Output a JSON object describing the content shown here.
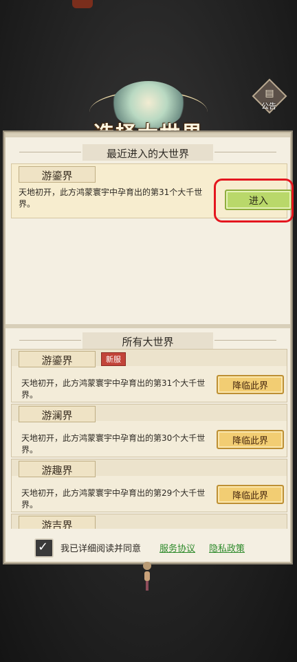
{
  "notice": {
    "label": "公告"
  },
  "title": {
    "text": "选择大世界"
  },
  "recent": {
    "section_title": "最近进入的大世界",
    "world": {
      "name": "游鎏界",
      "description": "天地初开，此方鸿蒙寰宇中孕育出的第31个大千世界。",
      "button": "进入"
    }
  },
  "all": {
    "section_title": "所有大世界",
    "worlds": [
      {
        "name": "游鎏界",
        "badge": "新服",
        "description": "天地初开，此方鸿蒙寰宇中孕育出的第31个大千世界。",
        "button": "降临此界"
      },
      {
        "name": "游澜界",
        "badge": "",
        "description": "天地初开，此方鸿蒙寰宇中孕育出的第30个大千世界。",
        "button": "降临此界"
      },
      {
        "name": "游趣界",
        "badge": "",
        "description": "天地初开，此方鸿蒙寰宇中孕育出的第29个大千世界。",
        "button": "降临此界"
      },
      {
        "name": "游吉界",
        "badge": "",
        "description": "",
        "button": ""
      }
    ]
  },
  "agreement": {
    "text": "我已详细阅读并同意",
    "service_link": "服务协议",
    "privacy_link": "隐私政策",
    "checked": true
  },
  "colors": {
    "highlight": "#e4161e",
    "enter_button": "#b9d86a",
    "descend_button": "#f2cd73",
    "link": "#2d8a2a"
  }
}
